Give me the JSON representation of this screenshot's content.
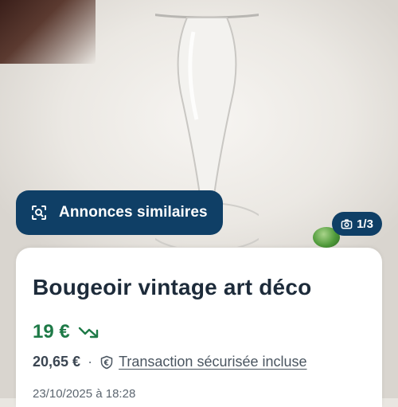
{
  "photo": {
    "counter_label": "1/3",
    "counter_icon": "camera-icon"
  },
  "similar_button": {
    "label": "Annonces similaires",
    "icon": "similar-search-icon"
  },
  "listing": {
    "title": "Bougeoir vintage art déco",
    "price": "19 €",
    "price_trend_icon": "price-drop-icon",
    "total_price": "20,65 €",
    "separator": "·",
    "secure_label": "Transaction sécurisée incluse",
    "secure_icon": "euro-shield-icon",
    "date": "23/10/2025 à 18:28"
  },
  "colors": {
    "brand": "#0f3f66",
    "price": "#1e7a47",
    "title": "#1d2b3a"
  }
}
